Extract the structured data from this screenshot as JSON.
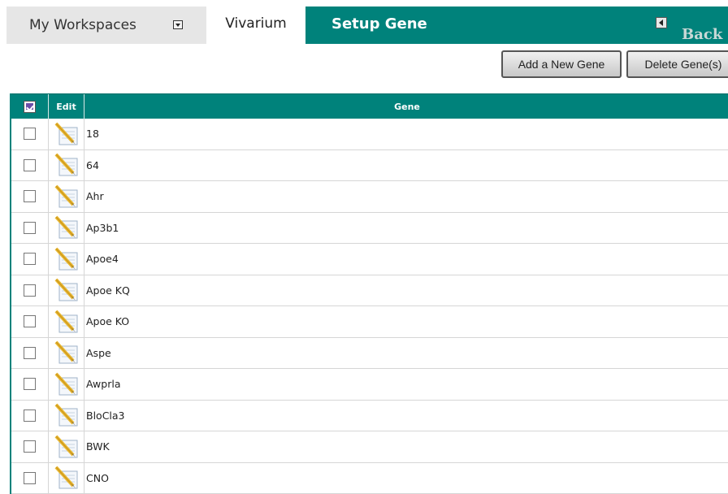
{
  "tabs": {
    "workspaces": "My Workspaces",
    "vivarium": "Vivarium",
    "setup_gene": "Setup Gene",
    "back": "Back"
  },
  "icons": {
    "workspaces_dropdown": "dropdown-arrow-icon",
    "back": "back-arrow-icon",
    "select_all": "checkbox-icon",
    "edit": "pencil-icon"
  },
  "colors": {
    "accent": "#00827b",
    "tab_inactive": "#e6e6e6"
  },
  "actions": {
    "add": "Add a New Gene",
    "delete": "Delete Gene(s)"
  },
  "table": {
    "headers": {
      "edit": "Edit",
      "gene": "Gene"
    },
    "rows": [
      "18",
      "64",
      "Ahr",
      "Ap3b1",
      "Apoe4",
      "Apoe KQ",
      "Apoe KO",
      "Aspe",
      "Awprla",
      "BloCla3",
      "BWK",
      "CNO"
    ]
  }
}
